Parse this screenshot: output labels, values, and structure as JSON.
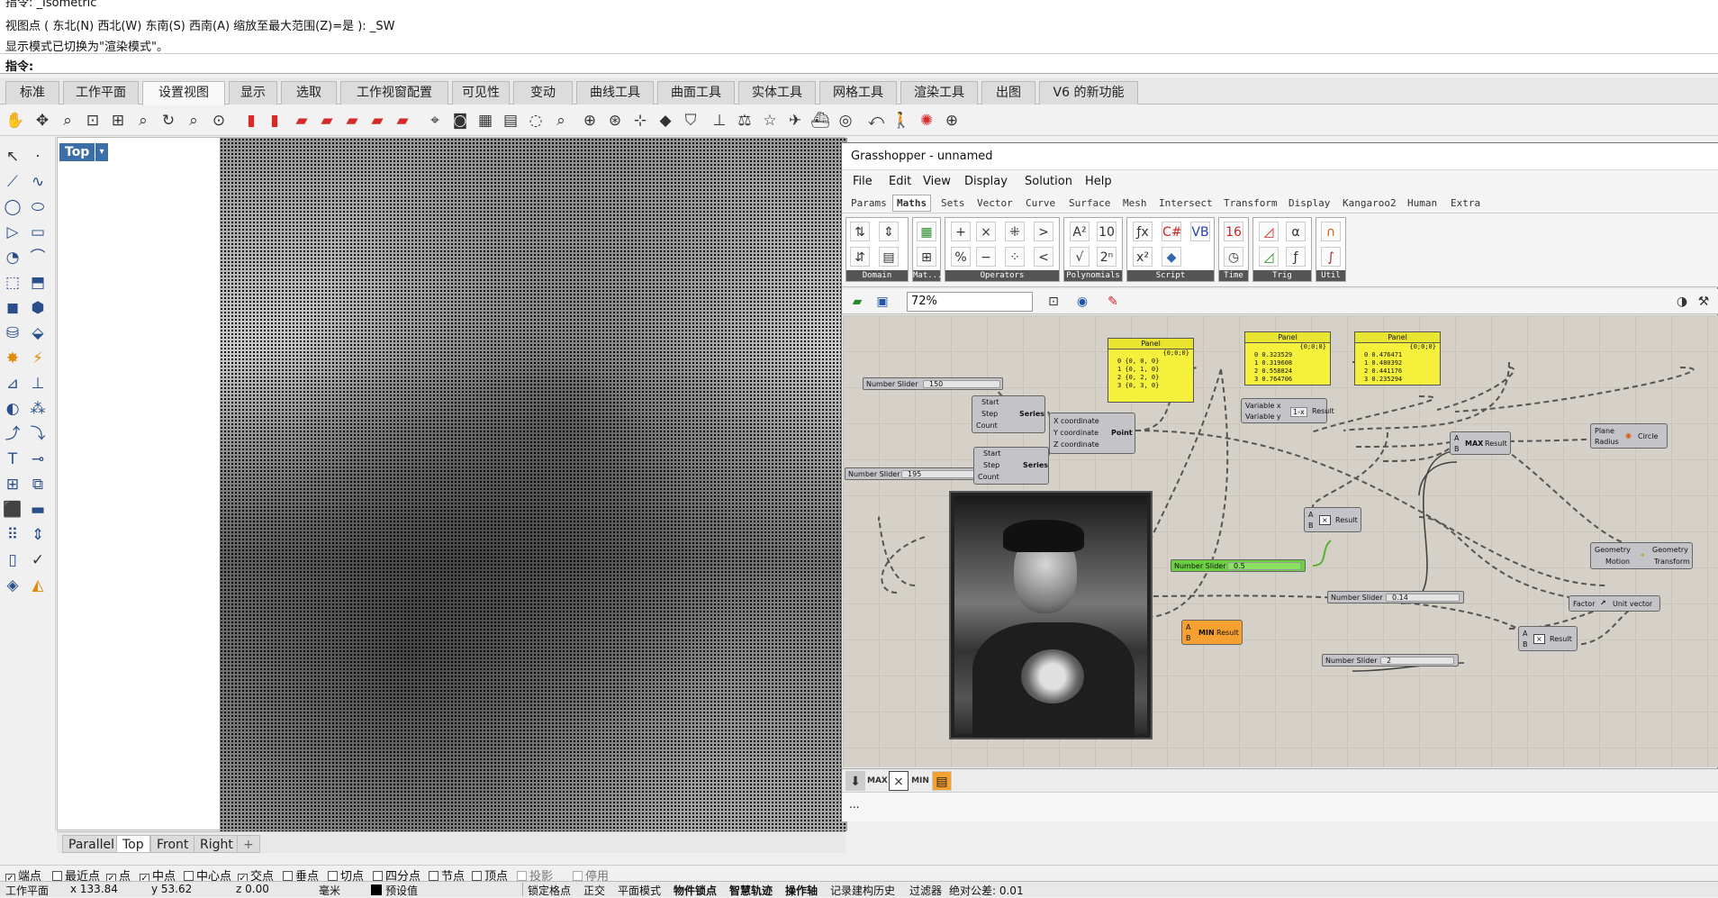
{
  "command": {
    "history": [
      "指令: _Isometric",
      "视图点 ( 东北(N)  西北(W)  东南(S)  西南(A)  缩放至最大范围(Z)=是 ): _SW",
      "显示模式已切换为\"渲染模式\"。"
    ],
    "prompt": "指令:"
  },
  "ribbon_tabs": [
    "标准",
    "工作平面",
    "设置视图",
    "显示",
    "选取",
    "工作视窗配置",
    "可见性",
    "变动",
    "曲线工具",
    "曲面工具",
    "实体工具",
    "网格工具",
    "渲染工具",
    "出图",
    "V6 的新功能"
  ],
  "active_tab": "设置视图",
  "viewport": {
    "name": "Top",
    "arrow": "▾",
    "tabs": [
      "Parallel",
      "Top",
      "Front",
      "Right"
    ],
    "add": "+"
  },
  "gh": {
    "title": "Grasshopper - unnamed",
    "menu": [
      "File",
      "Edit",
      "View",
      "Display",
      "Solution",
      "Help"
    ],
    "tabs": [
      "Params",
      "Maths",
      "Sets",
      "Vector",
      "Curve",
      "Surface",
      "Mesh",
      "Intersect",
      "Transform",
      "Display",
      "Kangaroo2",
      "Human",
      "Extra"
    ],
    "active_tab": "Maths",
    "groups": [
      "Domain",
      "Mat...",
      "Operators",
      "Polynomials",
      "Script",
      "Time",
      "Trig",
      "Util"
    ],
    "zoom": "72%",
    "nodes": {
      "slider1": {
        "label": "Number Slider",
        "value": "150"
      },
      "slider2": {
        "label": "Number Slider",
        "value": "195"
      },
      "slider3": {
        "label": "Number Slider",
        "value": "0.5"
      },
      "slider4": {
        "label": "Number Slider",
        "value": "0.14"
      },
      "slider5": {
        "label": "Number Slider",
        "value": "2"
      },
      "series": {
        "inputs": [
          "Start",
          "Step",
          "Count"
        ],
        "name": "Series"
      },
      "point": {
        "inputs": [
          "X coordinate",
          "Y coordinate",
          "Z coordinate"
        ],
        "name": "Point"
      },
      "panel_title": "Panel",
      "panel1": {
        "path": "{0;0;0}",
        "rows": [
          "0 {0, 0, 0}",
          "1 {0, 1, 0}",
          "2 {0, 2, 0}",
          "3 {0, 3, 0}"
        ]
      },
      "panel2": {
        "path": "{0;0;0}",
        "rows": [
          "0 0.323529",
          "1 0.319608",
          "2 0.558824",
          "3 0.764706"
        ]
      },
      "panel3": {
        "path": "{0;0;0}",
        "rows": [
          "0 0.476471",
          "1 0.480392",
          "2 0.441176",
          "3 0.235294"
        ]
      },
      "expr": {
        "inputs": [
          "Variable x",
          "Variable y"
        ],
        "label": "1-x",
        "output": "Result"
      },
      "max": {
        "inputs": [
          "A",
          "B"
        ],
        "label": "MAX",
        "output": "Result"
      },
      "min": {
        "inputs": [
          "A",
          "B"
        ],
        "label": "MIN",
        "output": "Result"
      },
      "mult1": {
        "inputs": [
          "A",
          "B"
        ],
        "output": "Result"
      },
      "mult2": {
        "inputs": [
          "A",
          "B"
        ],
        "output": "Result"
      },
      "circle": {
        "inputs": [
          "Plane",
          "Radius"
        ],
        "name": "Circle"
      },
      "geom": {
        "inputs": [
          "Geometry",
          "Motion"
        ],
        "name": "Geometry",
        "output": "Transform"
      },
      "unit": {
        "input": "Factor",
        "name": "Unit vector"
      }
    },
    "bottom_icons": [
      "MAX",
      "MIN"
    ],
    "status": "..."
  },
  "snaps": [
    {
      "label": "端点",
      "checked": true
    },
    {
      "label": "最近点",
      "checked": false
    },
    {
      "label": "点",
      "checked": true
    },
    {
      "label": "中点",
      "checked": true
    },
    {
      "label": "中心点",
      "checked": false
    },
    {
      "label": "交点",
      "checked": true
    },
    {
      "label": "垂点",
      "checked": false
    },
    {
      "label": "切点",
      "checked": false
    },
    {
      "label": "四分点",
      "checked": false
    },
    {
      "label": "节点",
      "checked": false
    },
    {
      "label": "顶点",
      "checked": false
    },
    {
      "label": "投影",
      "checked": false
    },
    {
      "label": "停用",
      "checked": false
    }
  ],
  "status": {
    "plane": "工作平面",
    "x": "x 133.84",
    "y": "y 53.62",
    "z": "z 0.00",
    "unit": "毫米",
    "layer": "预设值",
    "items": [
      "锁定格点",
      "正交",
      "平面模式",
      "物件锁点",
      "智慧轨迹",
      "操作轴",
      "记录建构历史",
      "过滤器",
      "绝对公差: 0.01"
    ]
  }
}
